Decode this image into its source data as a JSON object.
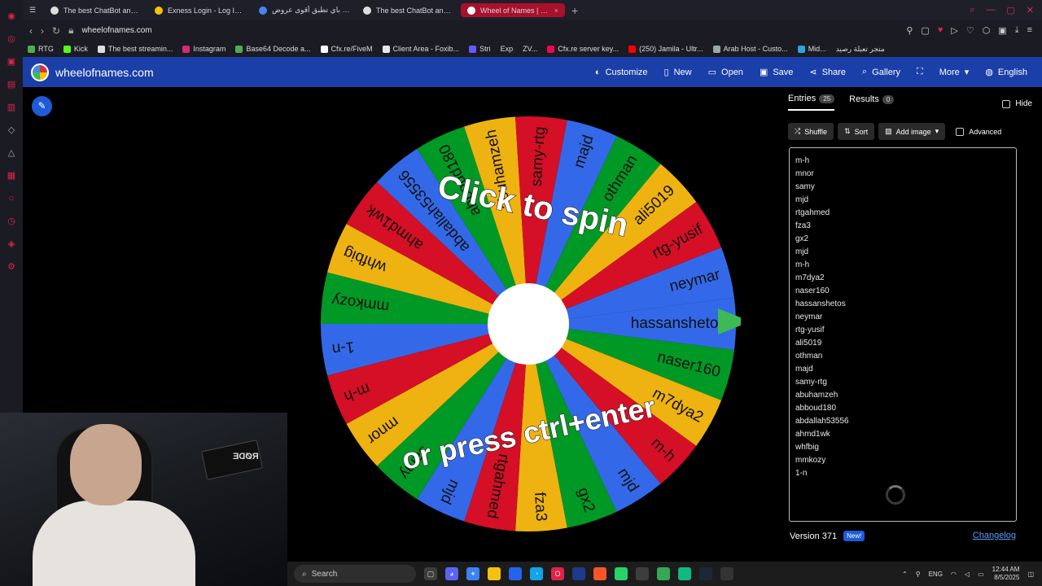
{
  "browser": {
    "tabs": [
      {
        "title": "The best ChatBot and Wi",
        "active": false
      },
      {
        "title": "Exness Login - Log In To",
        "active": false
      },
      {
        "title": "ميداس باي تطبق أقوى عروض",
        "active": false
      },
      {
        "title": "The best ChatBot and Wi",
        "active": false
      },
      {
        "title": "Wheel of Names | Rando",
        "active": true
      }
    ],
    "url": "wheelofnames.com",
    "bookmarks": [
      "RTG",
      "Kick",
      "The best streamin...",
      "Instagram",
      "Base64 Decode a...",
      "Cfx.re/FiveM",
      "Client Area - Foxib...",
      "Stri",
      "Exp",
      "ZV...",
      "Cfx.re server key...",
      "(250) Jamila - Ultr...",
      "Arab Host - Custo...",
      "Mid...",
      "متجر تعبلة رصيد"
    ]
  },
  "header": {
    "site_name": "wheelofnames.com",
    "menu": [
      {
        "label": "Customize",
        "icon": "palette-icon"
      },
      {
        "label": "New",
        "icon": "file-icon"
      },
      {
        "label": "Open",
        "icon": "folder-icon"
      },
      {
        "label": "Save",
        "icon": "save-icon"
      },
      {
        "label": "Share",
        "icon": "share-icon"
      },
      {
        "label": "Gallery",
        "icon": "search-icon"
      },
      {
        "label": "",
        "icon": "fullscreen-icon"
      },
      {
        "label": "More",
        "icon": "chevron-down-icon"
      },
      {
        "label": "English",
        "icon": "globe-icon"
      }
    ]
  },
  "wheel": {
    "line1": "Click to spin",
    "line2": "or press ctrl+enter",
    "colors": [
      "#3369e8",
      "#009925",
      "#eeb211",
      "#d50f25"
    ],
    "segments": [
      "hassanshetos",
      "naser160",
      "m7dya2",
      "m-h",
      "mjd",
      "gx2",
      "fza3",
      "rtgahmed",
      "mjd",
      "samy",
      "mnor",
      "m-h",
      "1-n",
      "mmkozy",
      "whfbig",
      "ahmd1wk",
      "abdallah53556",
      "abboud180",
      "abuhamzeh",
      "samy-rtg",
      "majd",
      "othman",
      "ali5019",
      "rtg-yusif",
      "neymar"
    ]
  },
  "panel": {
    "entries_tab": "Entries",
    "entries_count": "25",
    "results_tab": "Results",
    "results_count": "0",
    "hide_label": "Hide",
    "shuffle_label": "Shuffle",
    "sort_label": "Sort",
    "add_image_label": "Add image",
    "advanced_label": "Advanced",
    "entries": [
      "m-h",
      "mnor",
      "samy",
      "mjd",
      "rtgahmed",
      "fza3",
      "gx2",
      "mjd",
      "m-h",
      "m7dya2",
      "naser160",
      "hassanshetos",
      "neymar",
      "rtg-yusif",
      "ali5019",
      "othman",
      "majd",
      "samy-rtg",
      "abuhamzeh",
      "abboud180",
      "abdallah53556",
      "ahmd1wk",
      "whfbig",
      "mmkozy",
      "1-n"
    ],
    "version": "Version 371",
    "new_badge": "New!",
    "changelog": "Changelog"
  },
  "webcam": {
    "mic_brand": "RØDE"
  },
  "taskbar": {
    "search_placeholder": "Search",
    "lang": "ENG",
    "time": "12:44 AM",
    "date": "8/5/2025"
  }
}
